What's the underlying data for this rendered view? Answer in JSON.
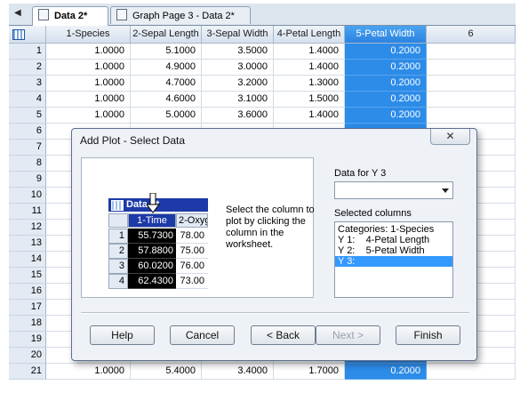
{
  "tabs": [
    {
      "label": "Data 2*",
      "active": true
    },
    {
      "label": "Graph Page 3 - Data 2*",
      "active": false
    }
  ],
  "grid": {
    "columns": [
      "1-Species",
      "2-Sepal Length",
      "3-Sepal Width",
      "4-Petal Length",
      "5-Petal Width",
      "6"
    ],
    "selected_column": "5-Petal Width",
    "rows": [
      {
        "n": "1",
        "c": [
          "1.0000",
          "5.1000",
          "3.5000",
          "1.4000",
          "0.2000",
          ""
        ]
      },
      {
        "n": "2",
        "c": [
          "1.0000",
          "4.9000",
          "3.0000",
          "1.4000",
          "0.2000",
          ""
        ]
      },
      {
        "n": "3",
        "c": [
          "1.0000",
          "4.7000",
          "3.2000",
          "1.3000",
          "0.2000",
          ""
        ]
      },
      {
        "n": "4",
        "c": [
          "1.0000",
          "4.6000",
          "3.1000",
          "1.5000",
          "0.2000",
          ""
        ]
      },
      {
        "n": "5",
        "c": [
          "1.0000",
          "5.0000",
          "3.6000",
          "1.4000",
          "0.2000",
          ""
        ]
      },
      {
        "n": "6",
        "c": [
          "",
          "",
          "",
          "",
          "",
          ""
        ]
      },
      {
        "n": "7",
        "c": [
          "",
          "",
          "",
          "",
          "",
          ""
        ]
      },
      {
        "n": "8",
        "c": [
          "",
          "",
          "",
          "",
          "",
          ""
        ]
      },
      {
        "n": "9",
        "c": [
          "",
          "",
          "",
          "",
          "",
          ""
        ]
      },
      {
        "n": "10",
        "c": [
          "",
          "",
          "",
          "",
          "",
          ""
        ]
      },
      {
        "n": "11",
        "c": [
          "",
          "",
          "",
          "",
          "",
          ""
        ]
      },
      {
        "n": "12",
        "c": [
          "",
          "",
          "",
          "",
          "",
          ""
        ]
      },
      {
        "n": "13",
        "c": [
          "",
          "",
          "",
          "",
          "",
          ""
        ]
      },
      {
        "n": "14",
        "c": [
          "",
          "",
          "",
          "",
          "",
          ""
        ]
      },
      {
        "n": "15",
        "c": [
          "",
          "",
          "",
          "",
          "",
          ""
        ]
      },
      {
        "n": "16",
        "c": [
          "",
          "",
          "",
          "",
          "",
          ""
        ]
      },
      {
        "n": "17",
        "c": [
          "",
          "",
          "",
          "",
          "",
          ""
        ]
      },
      {
        "n": "18",
        "c": [
          "",
          "",
          "",
          "",
          "",
          ""
        ]
      },
      {
        "n": "19",
        "c": [
          "",
          "",
          "",
          "",
          "",
          ""
        ]
      },
      {
        "n": "20",
        "c": [
          "",
          "",
          "",
          "",
          "",
          ""
        ]
      },
      {
        "n": "21",
        "c": [
          "1.0000",
          "5.4000",
          "3.4000",
          "1.7000",
          "0.2000",
          ""
        ]
      }
    ]
  },
  "dialog": {
    "title": "Add Plot - Select Data",
    "close_label": "✕",
    "preview": {
      "worksheet_title": "Data 1*",
      "columns": [
        "1-Time",
        "2-Oxyg"
      ],
      "rows": [
        {
          "n": "1",
          "a": "55.7300",
          "b": "78.00"
        },
        {
          "n": "2",
          "a": "57.8800",
          "b": "75.00"
        },
        {
          "n": "3",
          "a": "60.0200",
          "b": "76.00"
        },
        {
          "n": "4",
          "a": "62.4300",
          "b": "73.00"
        }
      ],
      "instruction": "Select the column to plot by clicking the column in the worksheet."
    },
    "data_for_label": "Data for Y 3",
    "combo_value": "",
    "selected_columns_label": "Selected columns",
    "selected_columns": [
      "Categories: 1-Species",
      "Y 1:    4-Petal Length",
      "Y 2:    5-Petal Width",
      "Y 3:"
    ],
    "selected_index": 3,
    "buttons": {
      "help": "Help",
      "cancel": "Cancel",
      "back": "< Back",
      "next": "Next >",
      "finish": "Finish"
    }
  }
}
